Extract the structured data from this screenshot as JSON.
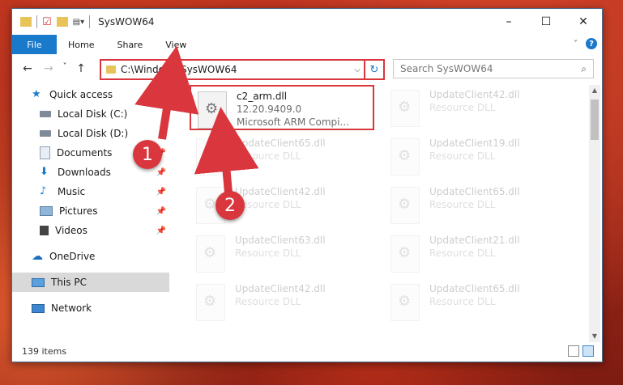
{
  "window": {
    "title": "SysWOW64",
    "controls": {
      "minimize": "–",
      "maximize": "☐",
      "close": "✕"
    }
  },
  "ribbon": {
    "file_label": "File",
    "tabs": [
      "Home",
      "Share",
      "View"
    ],
    "help": "?"
  },
  "address": {
    "path": "C:\\Windows\\SysWOW64",
    "search_placeholder": "Search SysWOW64"
  },
  "nav_buttons": {
    "back": "←",
    "forward": "→",
    "recent": "˅",
    "up": "↑"
  },
  "sidebar": {
    "items": [
      {
        "label": "Quick access",
        "icon": "star-icon",
        "pinned": false
      },
      {
        "label": "Local Disk (C:)",
        "icon": "drive-icon",
        "pinned": false
      },
      {
        "label": "Local Disk (D:)",
        "icon": "drive-icon",
        "pinned": false
      },
      {
        "label": "Documents",
        "icon": "documents-icon",
        "pinned": true
      },
      {
        "label": "Downloads",
        "icon": "download-icon",
        "pinned": true
      },
      {
        "label": "Music",
        "icon": "music-icon",
        "pinned": true
      },
      {
        "label": "Pictures",
        "icon": "pictures-icon",
        "pinned": true
      },
      {
        "label": "Videos",
        "icon": "videos-icon",
        "pinned": true
      },
      {
        "label": "OneDrive",
        "icon": "cloud-icon",
        "pinned": false
      },
      {
        "label": "This PC",
        "icon": "computer-icon",
        "pinned": false,
        "selected": true
      },
      {
        "label": "Network",
        "icon": "network-icon",
        "pinned": false
      }
    ]
  },
  "files": [
    {
      "name": "c2_arm.dll",
      "line2": "12.20.9409.0",
      "line3": "Microsoft ARM Compi...",
      "highlighted": true
    },
    {
      "name": "UpdateClient42.dll",
      "line2": "Resource DLL"
    },
    {
      "name": "UpdateClient65.dll",
      "line2": "Resource DLL"
    },
    {
      "name": "UpdateClient19.dll",
      "line2": "Resource DLL"
    },
    {
      "name": "UpdateClient42.dll",
      "line2": "Resource DLL"
    },
    {
      "name": "UpdateClient65.dll",
      "line2": "Resource DLL"
    },
    {
      "name": "UpdateClient63.dll",
      "line2": "Resource DLL"
    },
    {
      "name": "UpdateClient21.dll",
      "line2": "Resource DLL"
    },
    {
      "name": "UpdateClient42.dll",
      "line2": "Resource DLL"
    },
    {
      "name": "UpdateClient65.dll",
      "line2": "Resource DLL"
    }
  ],
  "status": {
    "items_count": "139 items"
  },
  "annotations": {
    "step1": "1",
    "step2": "2",
    "color": "#d9363e"
  }
}
